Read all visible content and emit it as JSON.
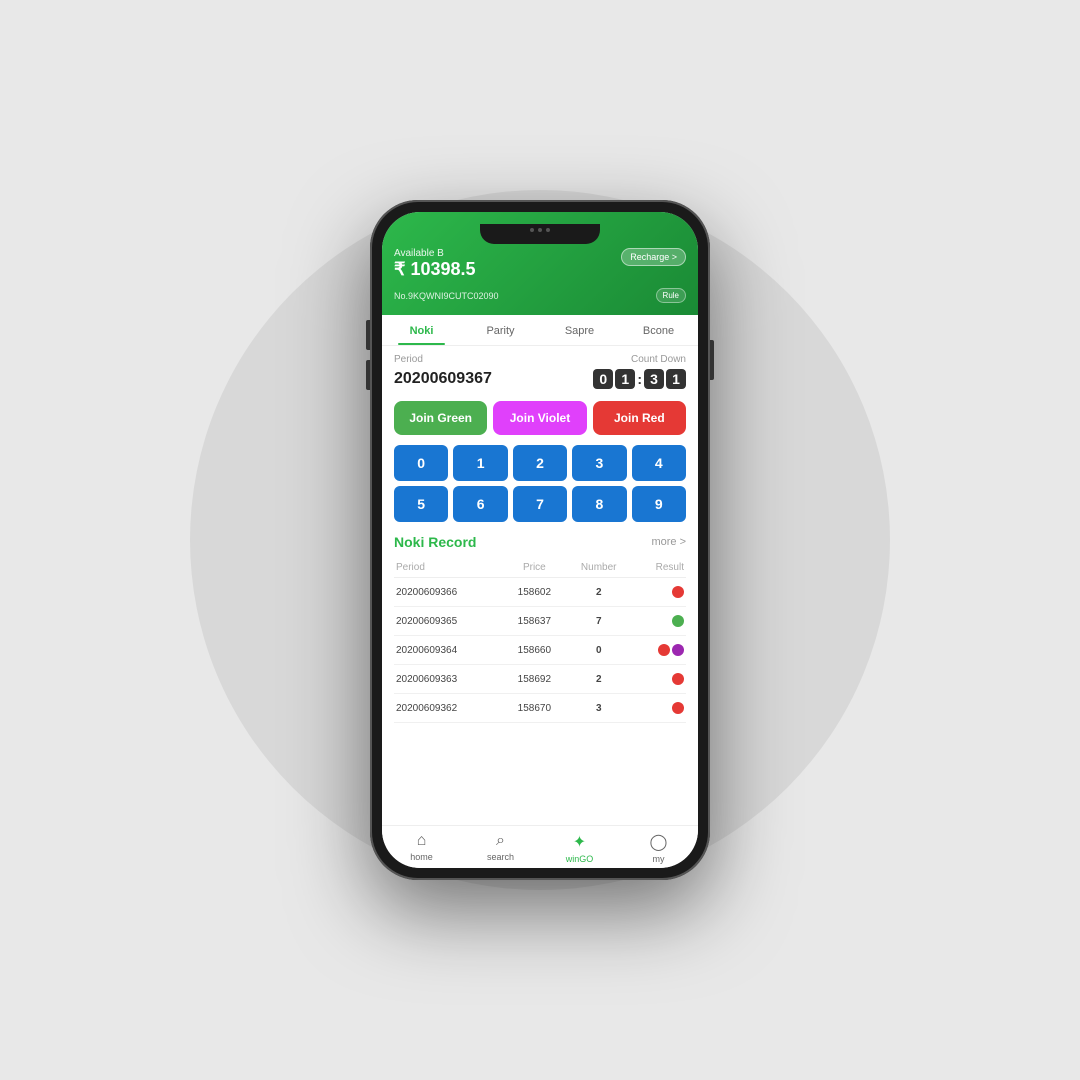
{
  "phone": {
    "header": {
      "available_label": "Available B",
      "balance": "₹ 10398.5",
      "period_id": "No.9KQWNI9CUTC02090",
      "recharge_label": "Recharge >",
      "rule_label": "Rule"
    },
    "tabs": [
      {
        "id": "noki",
        "label": "Noki",
        "active": true
      },
      {
        "id": "parity",
        "label": "Parity",
        "active": false
      },
      {
        "id": "sapre",
        "label": "Sapre",
        "active": false
      },
      {
        "id": "bcone",
        "label": "Bcone",
        "active": false
      }
    ],
    "game": {
      "period_label": "Period",
      "countdown_label": "Count Down",
      "period_number": "20200609367",
      "countdown": [
        "0",
        "1",
        "3",
        "1"
      ],
      "join_green": "Join Green",
      "join_violet": "Join Violet",
      "join_red": "Join Red",
      "numbers": [
        "0",
        "1",
        "2",
        "3",
        "4",
        "5",
        "6",
        "7",
        "8",
        "9"
      ]
    },
    "record": {
      "title": "Noki Record",
      "more_label": "more >",
      "columns": [
        "Period",
        "Price",
        "Number",
        "Result"
      ],
      "rows": [
        {
          "period": "20200609366",
          "price": "158602",
          "number": "2",
          "number_color": "red",
          "results": [
            "red"
          ]
        },
        {
          "period": "20200609365",
          "price": "158637",
          "number": "7",
          "number_color": "green",
          "results": [
            "green"
          ]
        },
        {
          "period": "20200609364",
          "price": "158660",
          "number": "0",
          "number_color": "red",
          "results": [
            "red",
            "violet"
          ]
        },
        {
          "period": "20200609363",
          "price": "158692",
          "number": "2",
          "number_color": "red",
          "results": [
            "red"
          ]
        },
        {
          "period": "20200609362",
          "price": "158670",
          "number": "3",
          "number_color": "red",
          "results": [
            "red"
          ]
        }
      ]
    },
    "bottom_nav": [
      {
        "id": "home",
        "label": "home",
        "icon": "⌂",
        "active": false
      },
      {
        "id": "search",
        "label": "search",
        "icon": "⌕",
        "active": false
      },
      {
        "id": "wingo",
        "label": "winGO",
        "icon": "★",
        "active": true
      },
      {
        "id": "my",
        "label": "my",
        "icon": "◯",
        "active": false
      }
    ]
  }
}
